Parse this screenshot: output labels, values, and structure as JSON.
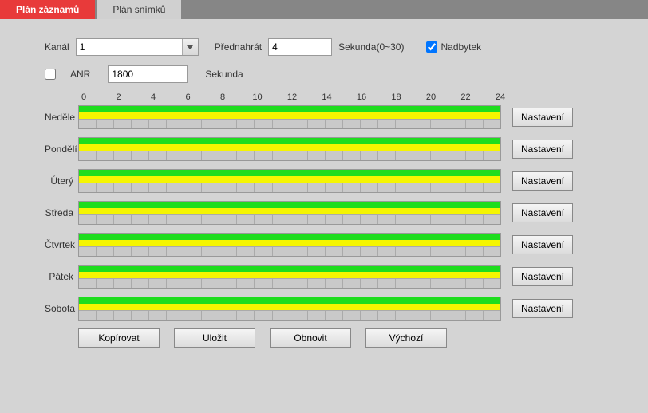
{
  "tabs": {
    "record_plan": "Plán záznamů",
    "snapshot_plan": "Plán snímků"
  },
  "controls": {
    "channel_label": "Kanál",
    "channel_value": "1",
    "prerecord_label": "Přednahrát",
    "prerecord_value": "4",
    "seconds_range_label": "Sekunda(0~30)",
    "redundancy_label": "Nadbytek",
    "redundancy_checked": true,
    "anr_label": "ANR",
    "anr_checked": false,
    "anr_value": "1800",
    "anr_seconds_label": "Sekunda"
  },
  "hours": [
    "0",
    "2",
    "4",
    "6",
    "8",
    "10",
    "12",
    "14",
    "16",
    "18",
    "20",
    "22",
    "24"
  ],
  "days": [
    {
      "name": "Neděle"
    },
    {
      "name": "Pondělí"
    },
    {
      "name": "Úterý"
    },
    {
      "name": "Středa"
    },
    {
      "name": "Čtvrtek"
    },
    {
      "name": "Pátek"
    },
    {
      "name": "Sobota"
    }
  ],
  "settings_button": "Nastavení",
  "buttons": {
    "copy": "Kopírovat",
    "save": "Uložit",
    "refresh": "Obnovit",
    "default": "Výchozí"
  }
}
